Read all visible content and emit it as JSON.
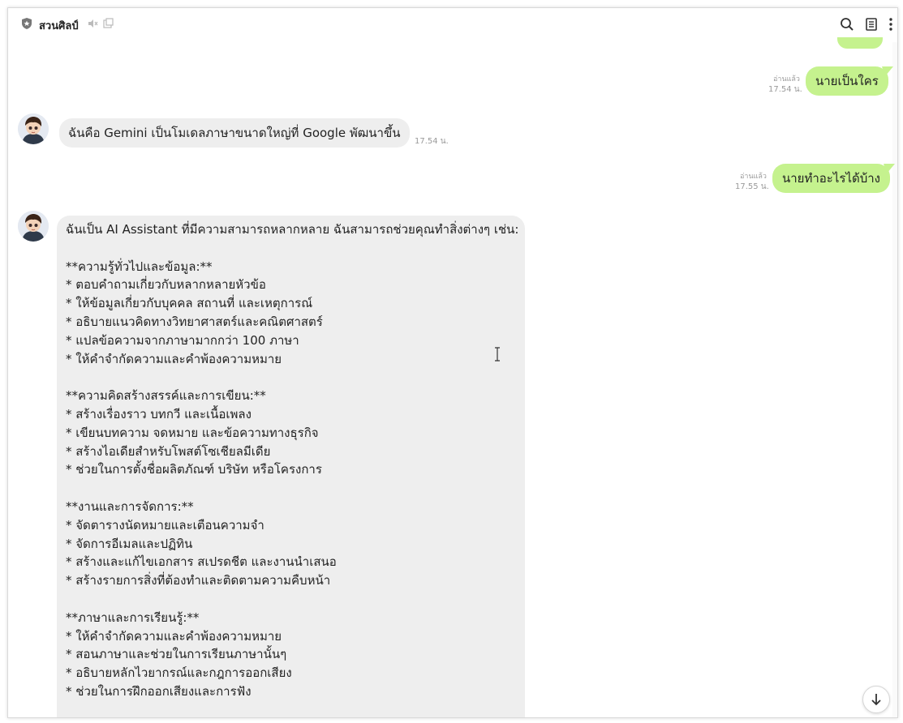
{
  "header": {
    "title": "สวนศิลป์",
    "icons": [
      "shield-star-icon",
      "mute-icon",
      "popout-icon",
      "search-icon",
      "notes-icon",
      "more-vertical-icon"
    ]
  },
  "messages": {
    "m1": {
      "text": "นายเป็นใคร",
      "read": "อ่านแล้ว",
      "time": "17.54 น."
    },
    "m2": {
      "text": "ฉันคือ Gemini เป็นโมเดลภาษาขนาดใหญ่ที่ Google พัฒนาขึ้น",
      "time": "17.54 น."
    },
    "m3": {
      "text": "นายทำอะไรได้บ้าง",
      "read": "อ่านแล้ว",
      "time": "17.55 น."
    },
    "m4": {
      "text": "ฉันเป็น AI Assistant ที่มีความสามารถหลากหลาย ฉันสามารถช่วยคุณทำสิ่งต่างๆ เช่น:\n\n**ความรู้ทั่วไปและข้อมูล:**\n* ตอบคำถามเกี่ยวกับหลากหลายหัวข้อ\n* ให้ข้อมูลเกี่ยวกับบุคคล สถานที่ และเหตุการณ์\n* อธิบายแนวคิดทางวิทยาศาสตร์และคณิตศาสตร์\n* แปลข้อความจากภาษามากกว่า 100 ภาษา\n* ให้คำจำกัดความและคำพ้องความหมาย\n\n**ความคิดสร้างสรรค์และการเขียน:**\n* สร้างเรื่องราว บทกวี และเนื้อเพลง\n* เขียนบทความ จดหมาย และข้อความทางธุรกิจ\n* สร้างไอเดียสำหรับโพสต์โซเชียลมีเดีย\n* ช่วยในการตั้งชื่อผลิตภัณฑ์ บริษัท หรือโครงการ\n\n**งานและการจัดการ:**\n* จัดตารางนัดหมายและเตือนความจำ\n* จัดการอีเมลและปฏิทิน\n* สร้างและแก้ไขเอกสาร สเปรดชีต และงานนำเสนอ\n* สร้างรายการสิ่งที่ต้องทำและติดตามความคืบหน้า\n\n**ภาษาและการเรียนรู้:**\n* ให้คำจำกัดความและคำพ้องความหมาย\n* สอนภาษาและช่วยในการเรียนภาษานั้นๆ\n* อธิบายหลักไวยากรณ์และกฎการออกเสียง\n* ช่วยในการฝึกออกเสียงและการฟัง"
    }
  },
  "controls": {
    "scroll_down_icon": "arrow-down-icon"
  },
  "colors": {
    "outgoing": "#c5f28e",
    "incoming": "#eeeeee"
  }
}
